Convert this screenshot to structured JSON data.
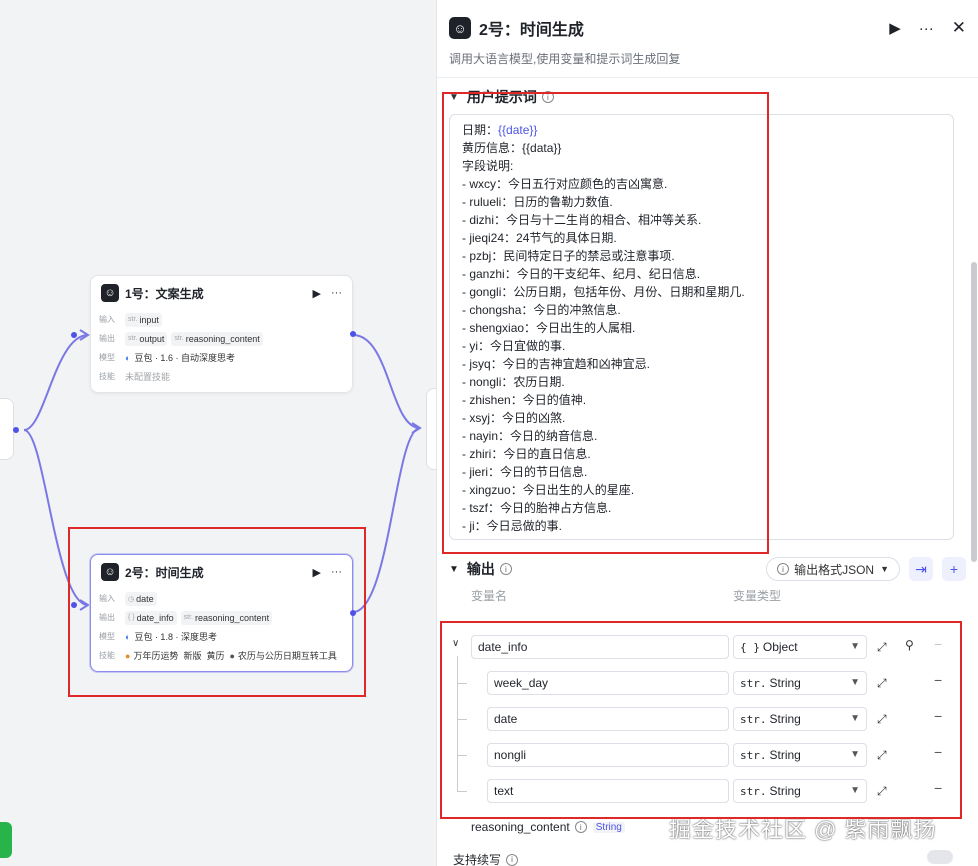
{
  "canvas": {
    "node1": {
      "title": "1号：文案生成",
      "input_label": "输入",
      "input_var": "input",
      "output_label": "输出",
      "output_vars": [
        "output",
        "reasoning_content"
      ],
      "model_label": "模型",
      "model_value": "豆包 · 1.6 · 自动深度思考",
      "skill_label": "技能",
      "skill_value": "未配置技能"
    },
    "node2": {
      "title": "2号：时间生成",
      "input_label": "输入",
      "input_var": "date",
      "output_label": "输出",
      "output_vars": [
        "date_info",
        "reasoning_content"
      ],
      "model_label": "模型",
      "model_value": "豆包 · 1.8 · 深度思考",
      "skill_label": "技能",
      "skill_values": [
        "万年历运势",
        "新版",
        "黄历",
        "农历与公历日期互转工具"
      ]
    },
    "type_prefix": "str."
  },
  "panel": {
    "title": "2号：时间生成",
    "description": "调用大语言模型,使用变量和提示词生成回复",
    "prompt_section": "用户提示词",
    "prompt_lines": [
      {
        "a": "日期：",
        "v": "{{date}}"
      },
      {
        "a": "黄历信息：{{data}}"
      },
      {
        "a": "字段说明:"
      },
      {
        "a": "- wxcy：今日五行对应颜色的吉凶寓意."
      },
      {
        "a": "- rulueli：日历的鲁勒力数值."
      },
      {
        "a": "- dizhi：今日与十二生肖的相合、相冲等关系."
      },
      {
        "a": "- jieqi24：24节气的具体日期."
      },
      {
        "a": "- pzbj：民间特定日子的禁忌或注意事项."
      },
      {
        "a": "- ganzhi：今日的干支纪年、纪月、纪日信息."
      },
      {
        "a": "- gongli：公历日期，包括年份、月份、日期和星期几."
      },
      {
        "a": "- chongsha：今日的冲煞信息."
      },
      {
        "a": "- shengxiao：今日出生的人属相."
      },
      {
        "a": "- yi：今日宜做的事."
      },
      {
        "a": "- jsyq：今日的吉神宜趋和凶神宜忌."
      },
      {
        "a": "- nongli：农历日期."
      },
      {
        "a": "- zhishen：今日的值神."
      },
      {
        "a": "- xsyj：今日的凶煞."
      },
      {
        "a": "- nayin：今日的纳音信息."
      },
      {
        "a": "- zhiri：今日的直日信息."
      },
      {
        "a": "- jieri：今日的节日信息."
      },
      {
        "a": "- xingzuo：今日出生的人的星座."
      },
      {
        "a": "- tszf：今日的胎神占方信息."
      },
      {
        "a": "- ji：今日忌做的事."
      }
    ],
    "output_section": "输出",
    "output_format": "输出格式JSON",
    "col_name": "变量名",
    "col_type": "变量类型",
    "vars": [
      {
        "name": "date_info",
        "type": "Object",
        "token": "{ }"
      },
      {
        "name": "week_day",
        "type": "String",
        "token": "str."
      },
      {
        "name": "date",
        "type": "String",
        "token": "str."
      },
      {
        "name": "nongli",
        "type": "String",
        "token": "str."
      },
      {
        "name": "text",
        "type": "String",
        "token": "str."
      }
    ],
    "reasoning_name": "reasoning_content",
    "reasoning_type": "String",
    "continue_label": "支持续写"
  },
  "watermark": "掘金技术社区 @ 紫雨飘扬",
  "colors": {
    "accent": "#4d53e8",
    "highlight": "#e02828",
    "edge": "#6f6fe0"
  }
}
